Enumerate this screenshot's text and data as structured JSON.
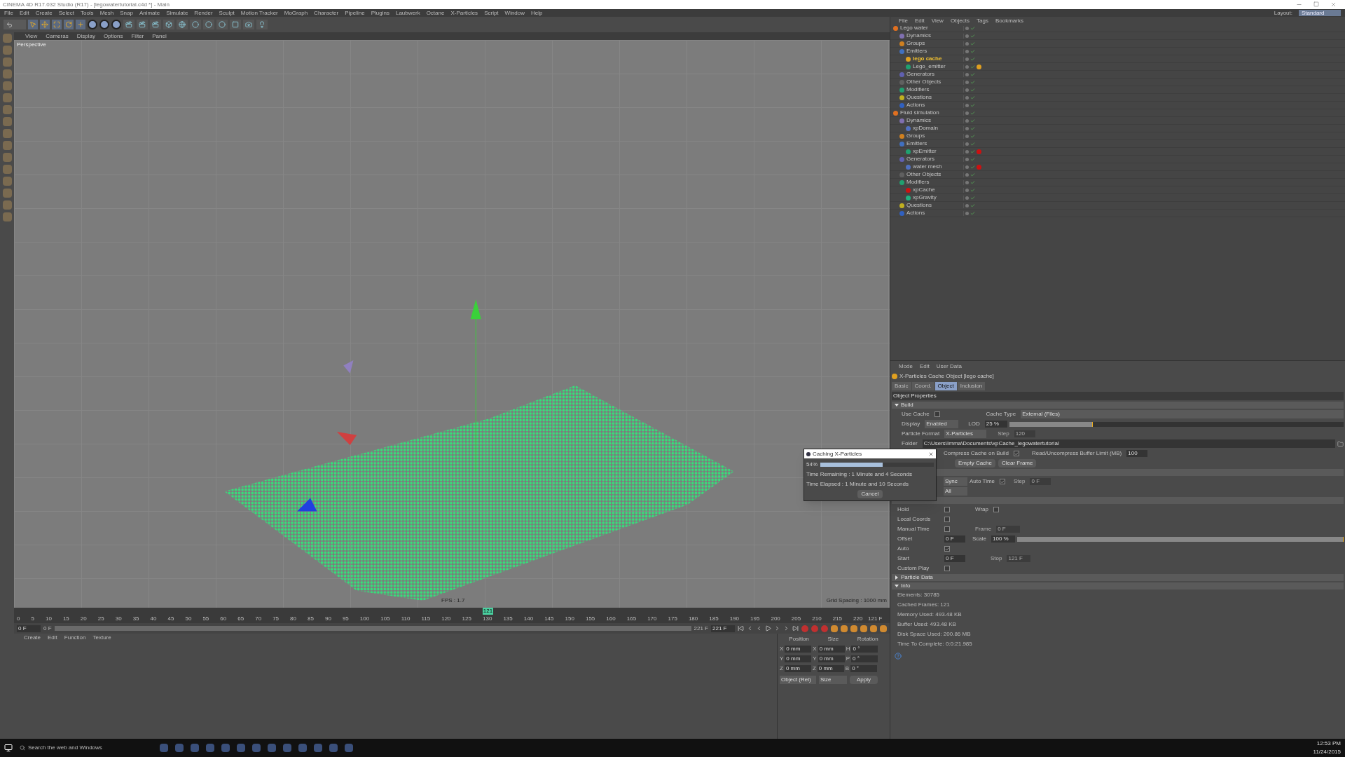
{
  "window": {
    "title": "CINEMA 4D R17.032 Studio (R17) - [legowatertutorial.c4d *] - Main",
    "layout_label": "Layout:",
    "layout_value": "Standard"
  },
  "menu": [
    "File",
    "Edit",
    "Create",
    "Select",
    "Tools",
    "Mesh",
    "Snap",
    "Animate",
    "Simulate",
    "Render",
    "Sculpt",
    "Motion Tracker",
    "MoGraph",
    "Character",
    "Pipeline",
    "Plugins",
    "Laubwerk",
    "Octane",
    "X-Particles",
    "Script",
    "Window",
    "Help"
  ],
  "viewport": {
    "menu": [
      "View",
      "Cameras",
      "Display",
      "Options",
      "Filter",
      "Panel"
    ],
    "camera": "Perspective",
    "fps": "FPS : 1.7",
    "grid_spacing": "Grid Spacing : 1000 mm"
  },
  "timeline": {
    "ticks": [
      "0",
      "5",
      "10",
      "15",
      "20",
      "25",
      "30",
      "35",
      "40",
      "45",
      "50",
      "55",
      "60",
      "65",
      "70",
      "75",
      "80",
      "85",
      "90",
      "95",
      "100",
      "105",
      "110",
      "115",
      "120",
      "125",
      "130",
      "135",
      "140",
      "145",
      "150",
      "155",
      "160",
      "165",
      "170",
      "175",
      "180",
      "185",
      "190",
      "195",
      "200",
      "205",
      "210",
      "215",
      "220"
    ],
    "current": "121",
    "level": 0.55,
    "end_label": "121 F",
    "start_field": "0 F",
    "range": {
      "start": "0 F",
      "end": "221 F",
      "level": 1
    },
    "end_field": "221 F"
  },
  "material_manager": {
    "menu": [
      "Create",
      "Edit",
      "Function",
      "Texture"
    ]
  },
  "coordinates": {
    "headers": [
      "Position",
      "Size",
      "Rotation"
    ],
    "rows": [
      {
        "axis": "X",
        "position": "0 mm",
        "size_axis": "X",
        "size": "0 mm",
        "rot_axis": "H",
        "rotation": "0 °"
      },
      {
        "axis": "Y",
        "position": "0 mm",
        "size_axis": "Y",
        "size": "0 mm",
        "rot_axis": "P",
        "rotation": "0 °"
      },
      {
        "axis": "Z",
        "position": "0 mm",
        "size_axis": "Z",
        "size": "0 mm",
        "rot_axis": "B",
        "rotation": "0 °"
      }
    ],
    "mode": "Object (Rel)",
    "size_mode": "Size",
    "apply": "Apply"
  },
  "object_manager": {
    "menu": [
      "File",
      "Edit",
      "View",
      "Objects",
      "Tags",
      "Bookmarks"
    ],
    "tree": [
      {
        "name": "Lego water",
        "color": "#e07020",
        "selected": false,
        "children": [
          {
            "name": "Dynamics",
            "color": "#8070b0",
            "selected": false
          },
          {
            "name": "Groups",
            "color": "#d08020",
            "selected": false
          },
          {
            "name": "Emitters",
            "color": "#4070c0",
            "selected": false,
            "children": [
              {
                "name": "lego cache",
                "color": "#e0a020",
                "selected": true
              },
              {
                "name": "Lego_emitter",
                "color": "#20a070",
                "selected": false,
                "tag": {
                  "color": "#e0a020"
                }
              }
            ]
          },
          {
            "name": "Generators",
            "color": "#6060b0",
            "selected": false
          },
          {
            "name": "Other Objects",
            "color": "#606060",
            "selected": false
          },
          {
            "name": "Modifiers",
            "color": "#20a070",
            "selected": false
          },
          {
            "name": "Questions",
            "color": "#c0b020",
            "selected": false
          },
          {
            "name": "Actions",
            "color": "#3060c0",
            "selected": false
          }
        ]
      },
      {
        "name": "Fluid simulation",
        "color": "#e07020",
        "selected": false,
        "children": [
          {
            "name": "Dynamics",
            "color": "#8070b0",
            "selected": false,
            "children": [
              {
                "name": "xpDomain",
                "color": "#5070c0",
                "selected": false
              }
            ]
          },
          {
            "name": "Groups",
            "color": "#d08020",
            "selected": false
          },
          {
            "name": "Emitters",
            "color": "#4070c0",
            "selected": false,
            "children": [
              {
                "name": "xpEmitter",
                "color": "#20a070",
                "selected": false,
                "tag": {
                  "color": "#cc1111"
                }
              }
            ]
          },
          {
            "name": "Generators",
            "color": "#6060b0",
            "selected": false,
            "children": [
              {
                "name": "water mesh",
                "color": "#5070c0",
                "selected": false,
                "tag": {
                  "color": "#cc1111"
                }
              }
            ]
          },
          {
            "name": "Other Objects",
            "color": "#606060",
            "selected": false
          },
          {
            "name": "Modifiers",
            "color": "#20a070",
            "selected": false,
            "children": [
              {
                "name": "xpCache",
                "color": "#cc1111",
                "selected": false
              },
              {
                "name": "xpGravity",
                "color": "#20b080",
                "selected": false
              }
            ]
          },
          {
            "name": "Questions",
            "color": "#c0b020",
            "selected": false
          },
          {
            "name": "Actions",
            "color": "#3060c0",
            "selected": false
          }
        ]
      }
    ]
  },
  "attributes": {
    "menu": [
      "Mode",
      "Edit",
      "User Data"
    ],
    "title": "X-Particles Cache Object [lego cache]",
    "tabs": [
      {
        "label": "Basic",
        "selected": false
      },
      {
        "label": "Coord.",
        "selected": false
      },
      {
        "label": "Object",
        "selected": true
      },
      {
        "label": "Inclusion",
        "selected": false
      }
    ],
    "group": "Object Properties",
    "build": "Build",
    "use_cache": {
      "label": "Use Cache",
      "checked": false
    },
    "cache_type": {
      "label": "Cache Type",
      "value": "External (Files)"
    },
    "display": {
      "label": "Display",
      "value": "Enabled"
    },
    "lod": {
      "label": "LOD",
      "value": "25 %",
      "level": 0.25
    },
    "particle_format": {
      "label": "Particle Format",
      "value": "X-Particles"
    },
    "step": {
      "label": "Step",
      "value": "120"
    },
    "folder": {
      "label": "Folder",
      "value": "C:\\Users\\Imma\\Documents\\xpCache_legowatertutorial"
    },
    "compress": {
      "label": "Compress Cache on Build",
      "checked": true
    },
    "buffer": {
      "label": "Read/Uncompress Buffer Limit (MB)",
      "value": "100"
    },
    "buttons": [
      "Empty Cache",
      "Clear Frame"
    ],
    "sync": {
      "value": "Sync"
    },
    "auto_time": {
      "label": "Auto Time",
      "checked": true
    },
    "sync_step": {
      "label": "Step",
      "value": "0 F"
    },
    "all": {
      "value": "All"
    },
    "playback": [
      {
        "label": "Hold",
        "checked": false,
        "right": {
          "label": "Wrap",
          "checked": false
        }
      },
      {
        "label": "Local Coords",
        "checked": false
      },
      {
        "label": "Manual Time",
        "checked": false,
        "right_field": {
          "label": "Frame",
          "value": "0 F"
        }
      },
      {
        "label": "Offset",
        "value": "0 F",
        "scale": {
          "label": "Scale",
          "value": "100 %",
          "level": 1
        }
      },
      {
        "label": "Auto",
        "checked": true
      },
      {
        "label": "Start",
        "value": "0 F",
        "right_field": {
          "label": "Stop",
          "value": "121 F"
        }
      },
      {
        "label": "Custom Play",
        "checked": false
      }
    ],
    "particle_data": "Particle Data",
    "info": "Info",
    "info_lines": [
      "Elements: 30785",
      "Cached Frames: 121",
      "Memory Used: 493.48 KB",
      "Buffer Used: 493.48 KB",
      "Disk Space Used: 200.86 MB",
      "Time To Complete: 0:0:21.985"
    ]
  },
  "dialog": {
    "title": "Caching X-Particles",
    "percent": "54%",
    "level": 0.55,
    "remaining": "Time Remaining : 1 Minute and 4 Seconds",
    "elapsed": "Time Elapsed : 1 Minute and 10 Seconds",
    "cancel": "Cancel"
  },
  "taskbar": {
    "search": "Search the web and Windows",
    "time": "12:53 PM",
    "date": "11/24/2015"
  }
}
